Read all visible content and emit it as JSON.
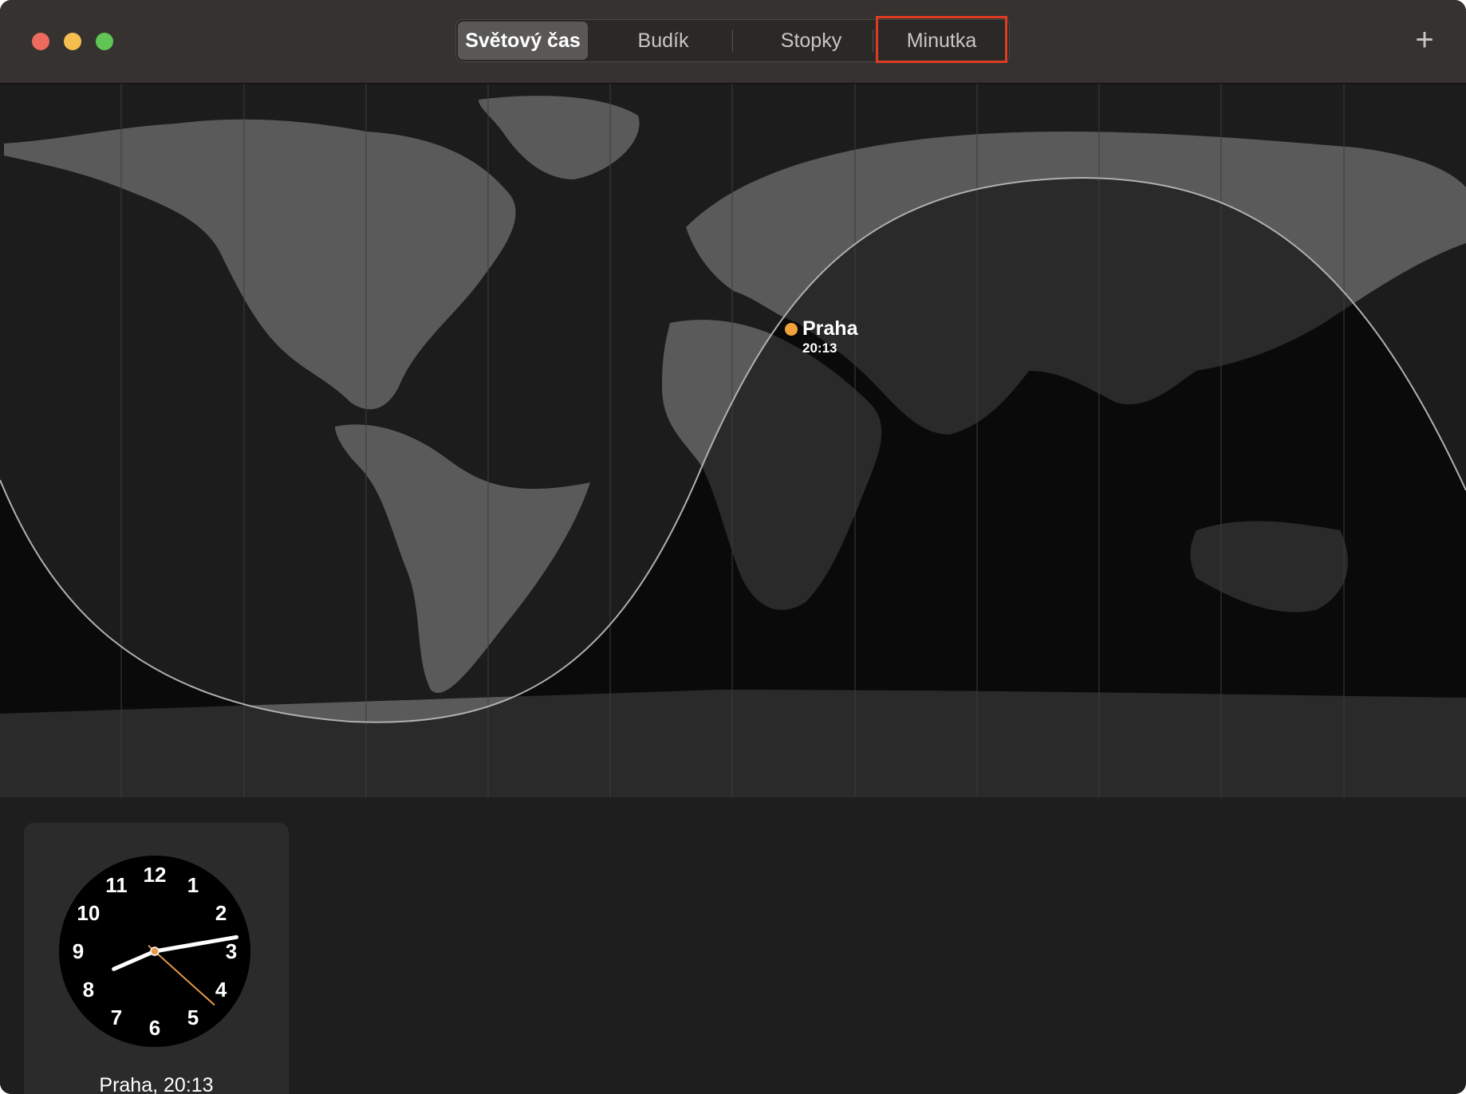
{
  "window": {
    "tabs": [
      {
        "label": "Světový čas",
        "active": true
      },
      {
        "label": "Budík",
        "active": false
      },
      {
        "label": "Stopky",
        "active": false
      },
      {
        "label": "Minutka",
        "active": false
      }
    ],
    "highlighted_tab": "Minutka",
    "add_button": "+"
  },
  "map": {
    "city": {
      "name": "Praha",
      "time": "20:13"
    },
    "colors": {
      "land": "#5a5a5a",
      "ocean_day": "#1c1c1c",
      "night": "#0a0a0a",
      "terminator": "#b0b0b0",
      "marker": "#f0a33a"
    }
  },
  "clocks": [
    {
      "caption": "Praha, 20:13",
      "numerals": [
        "12",
        "1",
        "2",
        "3",
        "4",
        "5",
        "6",
        "7",
        "8",
        "9",
        "10",
        "11"
      ],
      "hour": 8,
      "minute": 13,
      "second": 22
    }
  ]
}
